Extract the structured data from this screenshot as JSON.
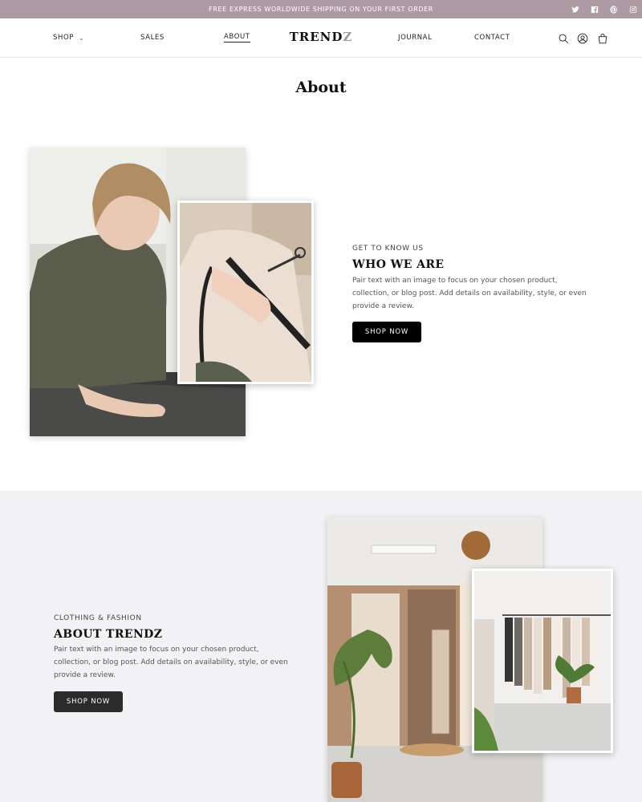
{
  "announcement": "FREE EXPRESS WORLDWIDE SHIPPING ON YOUR FIRST ORDER",
  "social": [
    "twitter-icon",
    "facebook-icon",
    "pinterest-icon",
    "instagram-icon"
  ],
  "nav": {
    "shop": "SHOP",
    "sales": "SALES",
    "about": "ABOUT",
    "journal": "JOURNAL",
    "contact": "CONTACT",
    "logo_main": "TREND",
    "logo_accent": "Z"
  },
  "header_icons": [
    "search-icon",
    "account-icon",
    "cart-icon"
  ],
  "page_title": "About",
  "section1": {
    "eyebrow": "GET TO KNOW US",
    "heading": "WHO WE ARE",
    "body": "Pair text with an image to focus on your chosen product, collection, or blog post. Add details on availability, style, or even provide a review.",
    "button": "SHOP NOW"
  },
  "section2": {
    "eyebrow": "CLOTHING & FASHION",
    "heading": "ABOUT TRENDZ",
    "body": "Pair text with an image to focus on your chosen product, collection, or blog post. Add details on availability, style, or even provide a review.",
    "button": "SHOP NOW"
  },
  "colors": {
    "announcement_bg": "#ad9aa3",
    "section2_bg": "#f2f1f4",
    "button1_bg": "#000000",
    "button2_bg": "#2b2b2b"
  }
}
